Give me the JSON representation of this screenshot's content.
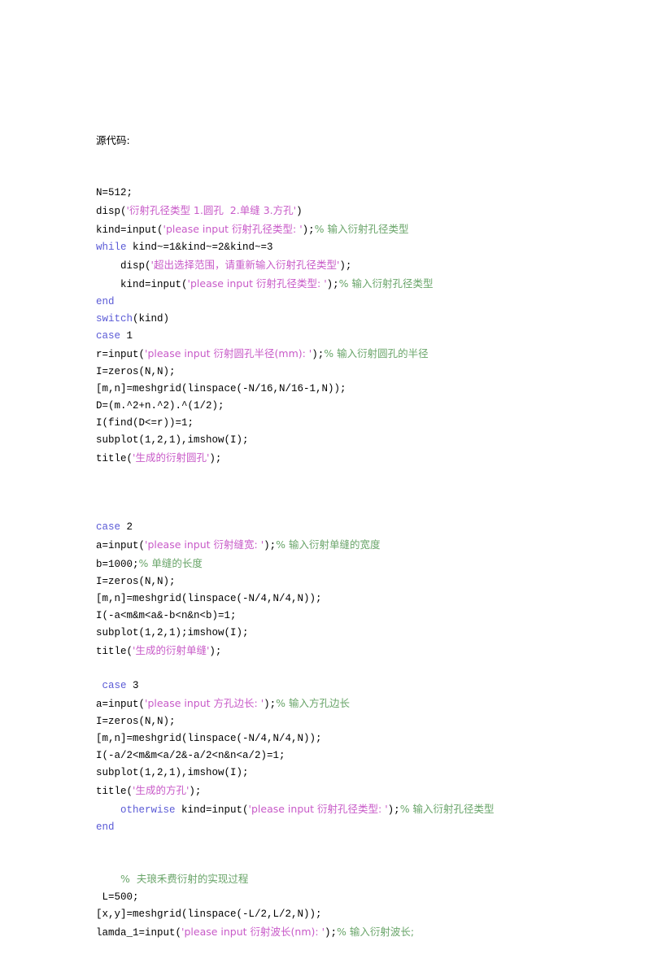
{
  "document": {
    "heading": "源代码:",
    "language": "MATLAB",
    "colors": {
      "text": "#000000",
      "keyword": "#5a5ad6",
      "string": "#c85ac8",
      "comment": "#6aa56a",
      "background": "#ffffff"
    }
  },
  "code_lines": [
    {
      "id": "line-1",
      "indent": "",
      "tokens": [
        {
          "t": "plain",
          "v": "N=512;"
        }
      ]
    },
    {
      "id": "line-2",
      "indent": "",
      "tokens": [
        {
          "t": "plain",
          "v": "disp("
        },
        {
          "t": "str",
          "v": "'衍射孔径类型 1.圆孔  2.单缝 3.方孔'"
        },
        {
          "t": "plain",
          "v": ")"
        }
      ]
    },
    {
      "id": "line-3",
      "indent": "",
      "tokens": [
        {
          "t": "plain",
          "v": "kind=input("
        },
        {
          "t": "str",
          "v": "'please input 衍射孔径类型: '"
        },
        {
          "t": "plain",
          "v": ");"
        },
        {
          "t": "cmt",
          "v": "% 输入衍射孔径类型"
        }
      ]
    },
    {
      "id": "line-4",
      "indent": "",
      "tokens": [
        {
          "t": "kw",
          "v": "while"
        },
        {
          "t": "plain",
          "v": " kind~=1&kind~=2&kind~=3"
        }
      ]
    },
    {
      "id": "line-5",
      "indent": "    ",
      "tokens": [
        {
          "t": "plain",
          "v": "disp("
        },
        {
          "t": "str",
          "v": "'超出选择范围，请重新输入衍射孔径类型'"
        },
        {
          "t": "plain",
          "v": ");"
        }
      ]
    },
    {
      "id": "line-6",
      "indent": "    ",
      "tokens": [
        {
          "t": "plain",
          "v": "kind=input("
        },
        {
          "t": "str",
          "v": "'please input 衍射孔径类型: '"
        },
        {
          "t": "plain",
          "v": ");"
        },
        {
          "t": "cmt",
          "v": "% 输入衍射孔径类型"
        }
      ]
    },
    {
      "id": "line-7",
      "indent": "",
      "tokens": [
        {
          "t": "kw",
          "v": "end"
        }
      ]
    },
    {
      "id": "line-8",
      "indent": "",
      "tokens": [
        {
          "t": "kw",
          "v": "switch"
        },
        {
          "t": "plain",
          "v": "(kind)"
        }
      ]
    },
    {
      "id": "line-9",
      "indent": "",
      "tokens": [
        {
          "t": "kw",
          "v": "case"
        },
        {
          "t": "plain",
          "v": " 1"
        }
      ]
    },
    {
      "id": "line-10",
      "indent": "",
      "tokens": [
        {
          "t": "plain",
          "v": "r=input("
        },
        {
          "t": "str",
          "v": "'please input 衍射圆孔半径(mm): '"
        },
        {
          "t": "plain",
          "v": ");"
        },
        {
          "t": "cmt",
          "v": "% 输入衍射圆孔的半径"
        }
      ]
    },
    {
      "id": "line-11",
      "indent": "",
      "tokens": [
        {
          "t": "plain",
          "v": "I=zeros(N,N);"
        }
      ]
    },
    {
      "id": "line-12",
      "indent": "",
      "tokens": [
        {
          "t": "plain",
          "v": "[m,n]=meshgrid(linspace(-N/16,N/16-1,N));"
        }
      ]
    },
    {
      "id": "line-13",
      "indent": "",
      "tokens": [
        {
          "t": "plain",
          "v": "D=(m.^2+n.^2).^(1/2);"
        }
      ]
    },
    {
      "id": "line-14",
      "indent": "",
      "tokens": [
        {
          "t": "plain",
          "v": "I(find(D<=r))=1;"
        }
      ]
    },
    {
      "id": "line-15",
      "indent": "",
      "tokens": [
        {
          "t": "plain",
          "v": "subplot(1,2,1),imshow(I);"
        }
      ]
    },
    {
      "id": "line-16",
      "indent": "",
      "tokens": [
        {
          "t": "plain",
          "v": "title("
        },
        {
          "t": "str",
          "v": "'生成的衍射圆孔'"
        },
        {
          "t": "plain",
          "v": ");"
        }
      ]
    },
    {
      "id": "line-17",
      "indent": "",
      "tokens": []
    },
    {
      "id": "line-18",
      "indent": "",
      "tokens": []
    },
    {
      "id": "line-19",
      "indent": "",
      "tokens": []
    },
    {
      "id": "line-20",
      "indent": "",
      "tokens": [
        {
          "t": "kw",
          "v": "case"
        },
        {
          "t": "plain",
          "v": " 2"
        }
      ]
    },
    {
      "id": "line-21",
      "indent": "",
      "tokens": [
        {
          "t": "plain",
          "v": "a=input("
        },
        {
          "t": "str",
          "v": "'please input 衍射缝宽: '"
        },
        {
          "t": "plain",
          "v": ");"
        },
        {
          "t": "cmt",
          "v": "% 输入衍射单缝的宽度"
        }
      ]
    },
    {
      "id": "line-22",
      "indent": "",
      "tokens": [
        {
          "t": "plain",
          "v": "b=1000;"
        },
        {
          "t": "cmt",
          "v": "% 单缝的长度"
        }
      ]
    },
    {
      "id": "line-23",
      "indent": "",
      "tokens": [
        {
          "t": "plain",
          "v": "I=zeros(N,N);"
        }
      ]
    },
    {
      "id": "line-24",
      "indent": "",
      "tokens": [
        {
          "t": "plain",
          "v": "[m,n]=meshgrid(linspace(-N/4,N/4,N));"
        }
      ]
    },
    {
      "id": "line-25",
      "indent": "",
      "tokens": [
        {
          "t": "plain",
          "v": "I(-a<m&m<a&-b<n&n<b)=1;"
        }
      ]
    },
    {
      "id": "line-26",
      "indent": "",
      "tokens": [
        {
          "t": "plain",
          "v": "subplot(1,2,1);imshow(I);"
        }
      ]
    },
    {
      "id": "line-27",
      "indent": "",
      "tokens": [
        {
          "t": "plain",
          "v": "title("
        },
        {
          "t": "str",
          "v": "'生成的衍射单缝'"
        },
        {
          "t": "plain",
          "v": ");"
        }
      ]
    },
    {
      "id": "line-28",
      "indent": "",
      "tokens": []
    },
    {
      "id": "line-29",
      "indent": " ",
      "tokens": [
        {
          "t": "kw",
          "v": "case"
        },
        {
          "t": "plain",
          "v": " 3"
        }
      ]
    },
    {
      "id": "line-30",
      "indent": "",
      "tokens": [
        {
          "t": "plain",
          "v": "a=input("
        },
        {
          "t": "str",
          "v": "'please input 方孔边长: '"
        },
        {
          "t": "plain",
          "v": ");"
        },
        {
          "t": "cmt",
          "v": "% 输入方孔边长"
        }
      ]
    },
    {
      "id": "line-31",
      "indent": "",
      "tokens": [
        {
          "t": "plain",
          "v": "I=zeros(N,N);"
        }
      ]
    },
    {
      "id": "line-32",
      "indent": "",
      "tokens": [
        {
          "t": "plain",
          "v": "[m,n]=meshgrid(linspace(-N/4,N/4,N));"
        }
      ]
    },
    {
      "id": "line-33",
      "indent": "",
      "tokens": [
        {
          "t": "plain",
          "v": "I(-a/2<m&m<a/2&-a/2<n&n<a/2)=1;"
        }
      ]
    },
    {
      "id": "line-34",
      "indent": "",
      "tokens": [
        {
          "t": "plain",
          "v": "subplot(1,2,1),imshow(I);"
        }
      ]
    },
    {
      "id": "line-35",
      "indent": "",
      "tokens": [
        {
          "t": "plain",
          "v": "title("
        },
        {
          "t": "str",
          "v": "'生成的方孔'"
        },
        {
          "t": "plain",
          "v": ");"
        }
      ]
    },
    {
      "id": "line-36",
      "indent": "    ",
      "tokens": [
        {
          "t": "kw",
          "v": "otherwise"
        },
        {
          "t": "plain",
          "v": " kind=input("
        },
        {
          "t": "str",
          "v": "'please input 衍射孔径类型: '"
        },
        {
          "t": "plain",
          "v": ");"
        },
        {
          "t": "cmt",
          "v": "% 输入衍射孔径类型"
        }
      ]
    },
    {
      "id": "line-37",
      "indent": "",
      "tokens": [
        {
          "t": "kw",
          "v": "end"
        }
      ]
    },
    {
      "id": "line-38",
      "indent": "",
      "tokens": []
    },
    {
      "id": "line-39",
      "indent": "",
      "tokens": []
    },
    {
      "id": "line-40",
      "indent": "    ",
      "tokens": [
        {
          "t": "cmt",
          "v": "%  夫琅禾费衍射的实现过程"
        }
      ]
    },
    {
      "id": "line-41",
      "indent": " ",
      "tokens": [
        {
          "t": "plain",
          "v": "L=500;"
        }
      ]
    },
    {
      "id": "line-42",
      "indent": "",
      "tokens": [
        {
          "t": "plain",
          "v": "[x,y]=meshgrid(linspace(-L/2,L/2,N));"
        }
      ]
    },
    {
      "id": "line-43",
      "indent": "",
      "tokens": [
        {
          "t": "plain",
          "v": "lamda_1=input("
        },
        {
          "t": "str",
          "v": "'please input 衍射波长(nm): '"
        },
        {
          "t": "plain",
          "v": ");"
        },
        {
          "t": "cmt",
          "v": "% 输入衍射波长;"
        }
      ]
    }
  ]
}
